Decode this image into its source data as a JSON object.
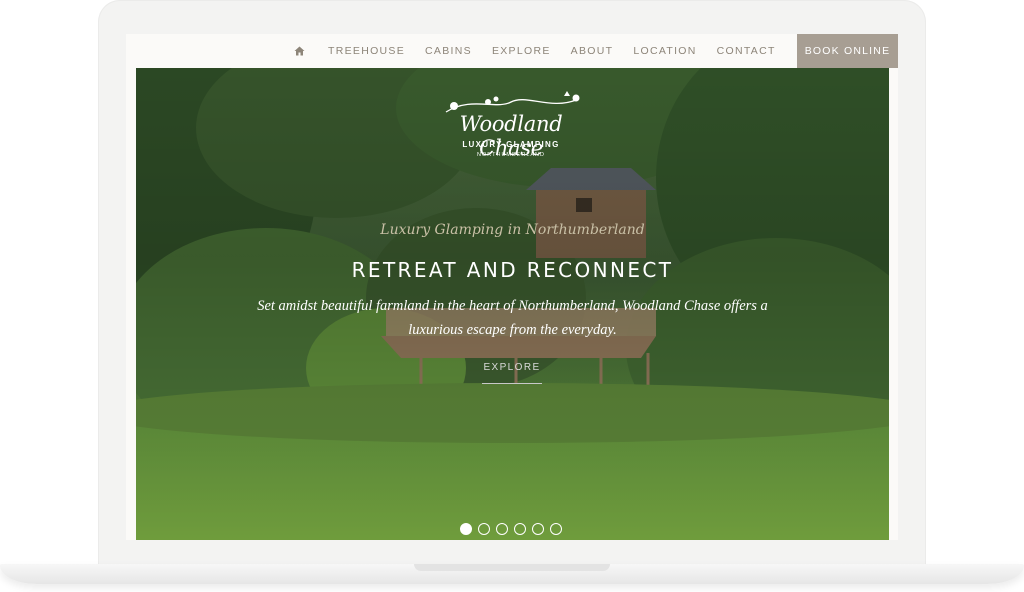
{
  "nav": {
    "home_icon": "home-icon",
    "items": [
      "TREEHOUSE",
      "CABINS",
      "EXPLORE",
      "ABOUT",
      "LOCATION",
      "CONTACT"
    ],
    "book_label": "BOOK ONLINE"
  },
  "hero": {
    "logo": {
      "title": "Woodland Chase",
      "subtitle": "LUXURY GLAMPING",
      "region": "NORTHUMBERLAND"
    },
    "tagline": "Luxury Glamping in Northumberland",
    "headline": "RETREAT AND RECONNECT",
    "intro": "Set amidst beautiful farmland in the heart of Northumberland, Woodland Chase offers a luxurious escape from the everyday.",
    "cta_label": "EXPLORE",
    "slides": {
      "count": 6,
      "active": 1
    }
  },
  "colors": {
    "accent": "#a79e93",
    "nav_text": "#8d8579",
    "tagline": "#c9c0a6",
    "frame": "#f3f3f2"
  }
}
